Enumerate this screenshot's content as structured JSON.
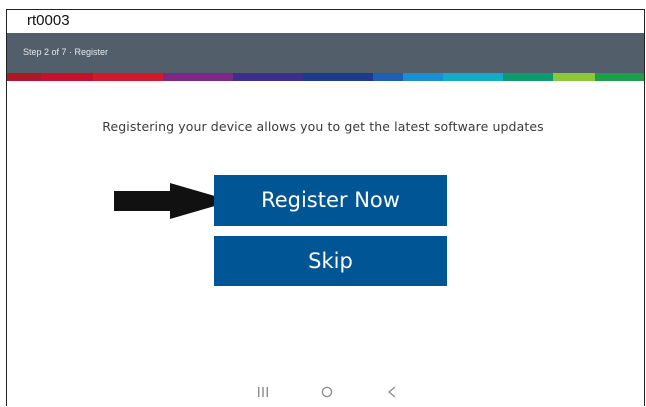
{
  "document": {
    "label": "rt0003"
  },
  "header": {
    "step_text": "Step 2 of 7 · Register",
    "background_color": "#525f6b",
    "stripe_colors": [
      "#b0182a",
      "#d2102b",
      "#7a2a85",
      "#3e2f8c",
      "#1e3a8a",
      "#1f63b5",
      "#1c8fd0",
      "#18a8c8",
      "#0f9a6d",
      "#21a34a",
      "#8cc63f",
      "#1e9e4a"
    ]
  },
  "main": {
    "info_text": "Registering your device allows you to get the latest software updates",
    "register_button_label": "Register Now",
    "skip_button_label": "Skip",
    "button_color": "#005694"
  },
  "annotation": {
    "icon": "arrow-right-icon"
  },
  "navigation": {
    "recent_icon": "recent-apps-icon",
    "home_icon": "home-icon",
    "back_icon": "back-icon"
  }
}
